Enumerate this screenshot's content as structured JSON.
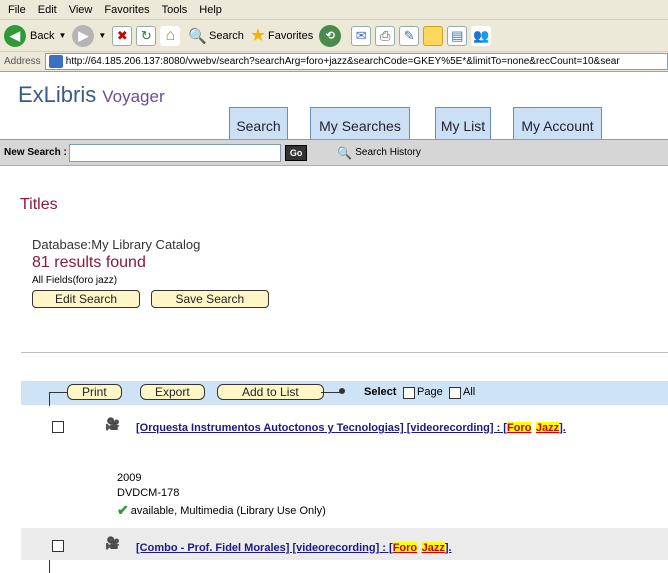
{
  "browser": {
    "menu": [
      "File",
      "Edit",
      "View",
      "Favorites",
      "Tools",
      "Help"
    ],
    "toolbar": {
      "back": "Back",
      "search": "Search",
      "favorites": "Favorites"
    },
    "address_label": "Address",
    "address_url": "http://64.185.206.137:8080/vwebv/search?searchArg=foro+jazz&searchCode=GKEY%5E*&limitTo=none&recCount=10&sear"
  },
  "header": {
    "logo_ex": "ExLibris",
    "logo_voyager": "Voyager",
    "tabs": [
      "Search",
      "My Searches",
      "My List",
      "My Account"
    ]
  },
  "searchbar": {
    "label": "New Search :",
    "go": "Go",
    "history": "Search History",
    "value": ""
  },
  "results": {
    "heading": "Titles",
    "database": "Database:My Library Catalog",
    "count_text": "81 results found",
    "query_text": "All Fields(foro jazz)",
    "edit_search": "Edit Search",
    "save_search": "Save Search",
    "actions": {
      "print": "Print",
      "export": "Export",
      "add_to_list": "Add to List",
      "select": "Select",
      "page": "Page",
      "all": "All"
    },
    "records": [
      {
        "title_main": "[Orquesta Instrumentos Autoctonos y Tecnologias] [videorecording] : [",
        "hl1": "Foro",
        "hl2": "Jazz",
        "title_end": "].",
        "year": "2009",
        "call": "DVDCM-178",
        "availability": "available, Multimedia (Library Use Only)"
      },
      {
        "title_main": "[Combo - Prof. Fidel Morales] [videorecording] : [",
        "hl1": "Foro",
        "hl2": "Jazz",
        "title_end": "]."
      }
    ]
  }
}
